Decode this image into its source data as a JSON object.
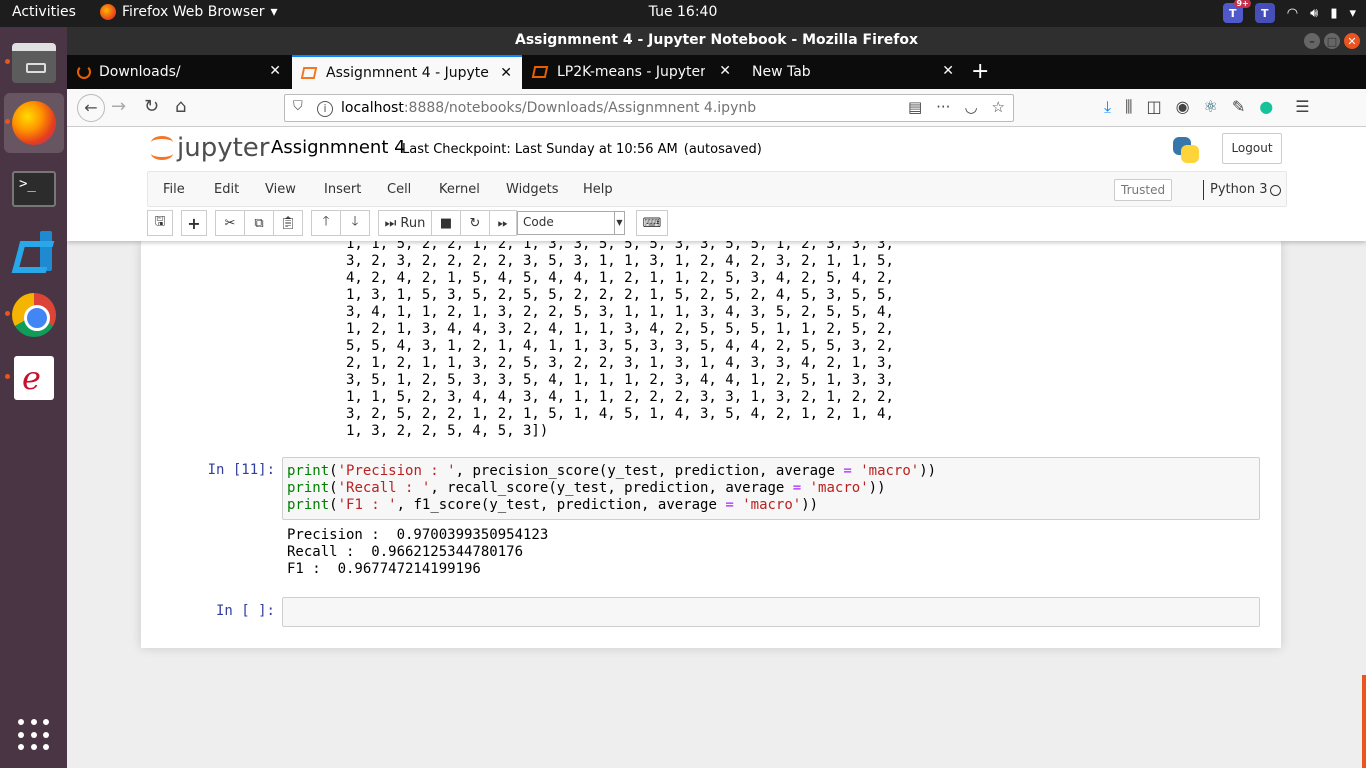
{
  "topbar": {
    "activities": "Activities",
    "app_name": "Firefox Web Browser",
    "clock": "Tue 16:40",
    "teams_badge": "9+"
  },
  "window": {
    "title": "Assignmnent 4 - Jupyter Notebook - Mozilla Firefox"
  },
  "tabs": [
    {
      "label": "Downloads/",
      "active": false
    },
    {
      "label": "Assignmnent 4 - Jupyter",
      "active": true
    },
    {
      "label": "LP2K-means - Jupyter No",
      "active": false
    },
    {
      "label": "New Tab",
      "active": false
    }
  ],
  "urlbar": {
    "host": "localhost",
    "rest": ":8888/notebooks/Downloads/Assignmnent 4.ipynb"
  },
  "jupyter": {
    "logo_text": "jupyter",
    "notebook_name": "Assignmnent 4",
    "checkpoint": "Last Checkpoint: Last Sunday at 10:56 AM",
    "autosave": "(autosaved)",
    "logout": "Logout",
    "menu": [
      "File",
      "Edit",
      "View",
      "Insert",
      "Cell",
      "Kernel",
      "Widgets",
      "Help"
    ],
    "trusted": "Trusted",
    "kernel": "Python 3",
    "run_label": "Run",
    "cell_type": "Code"
  },
  "cells": {
    "array_output": "1, 1, 5, 2, 2, 1, 2, 1, 3, 3, 5, 5, 5, 3, 3, 5, 5, 1, 2, 3, 3, 3,\n3, 2, 3, 2, 2, 2, 2, 3, 5, 3, 1, 1, 3, 1, 2, 4, 2, 3, 2, 1, 1, 5,\n4, 2, 4, 2, 1, 5, 4, 5, 4, 4, 1, 2, 1, 1, 2, 5, 3, 4, 2, 5, 4, 2,\n1, 3, 1, 5, 3, 5, 2, 5, 5, 2, 2, 2, 1, 5, 2, 5, 2, 4, 5, 3, 5, 5,\n3, 4, 1, 1, 2, 1, 3, 2, 2, 5, 3, 1, 1, 1, 3, 4, 3, 5, 2, 5, 5, 4,\n1, 2, 1, 3, 4, 4, 3, 2, 4, 1, 1, 3, 4, 2, 5, 5, 5, 1, 1, 2, 5, 2,\n5, 5, 4, 3, 1, 2, 1, 4, 1, 1, 3, 5, 3, 3, 5, 4, 4, 2, 5, 5, 3, 2,\n2, 1, 2, 1, 1, 3, 2, 5, 3, 2, 2, 3, 1, 3, 1, 4, 3, 3, 4, 2, 1, 3,\n3, 5, 1, 2, 5, 3, 3, 5, 4, 1, 1, 1, 2, 3, 4, 4, 1, 2, 5, 1, 3, 3,\n1, 1, 5, 2, 3, 4, 4, 3, 4, 1, 1, 2, 2, 2, 3, 3, 1, 3, 2, 1, 2, 2,\n3, 2, 5, 2, 2, 1, 2, 1, 5, 1, 4, 5, 1, 4, 3, 5, 4, 2, 1, 2, 1, 4,\n1, 3, 2, 2, 5, 4, 5, 3])",
    "prompt_11": "In [11]:",
    "code_lines": [
      {
        "print": "print",
        "open": "(",
        "str": "'Precision : '",
        "mid": ", precision_score(y_test, prediction, average ",
        "eq": "=",
        "sp": " ",
        "str2": "'macro'",
        "close": "))"
      },
      {
        "print": "print",
        "open": "(",
        "str": "'Recall : '",
        "mid": ", recall_score(y_test, prediction, average ",
        "eq": "=",
        "sp": " ",
        "str2": "'macro'",
        "close": "))"
      },
      {
        "print": "print",
        "open": "(",
        "str": "'F1 : '",
        "mid": ", f1_score(y_test, prediction, average ",
        "eq": "=",
        "sp": " ",
        "str2": "'macro'",
        "close": "))"
      }
    ],
    "metrics_output": "Precision :  0.9700399350954123\nRecall :  0.9662125344780176\nF1 :  0.967747214199196",
    "prompt_empty": "In [ ]:"
  }
}
